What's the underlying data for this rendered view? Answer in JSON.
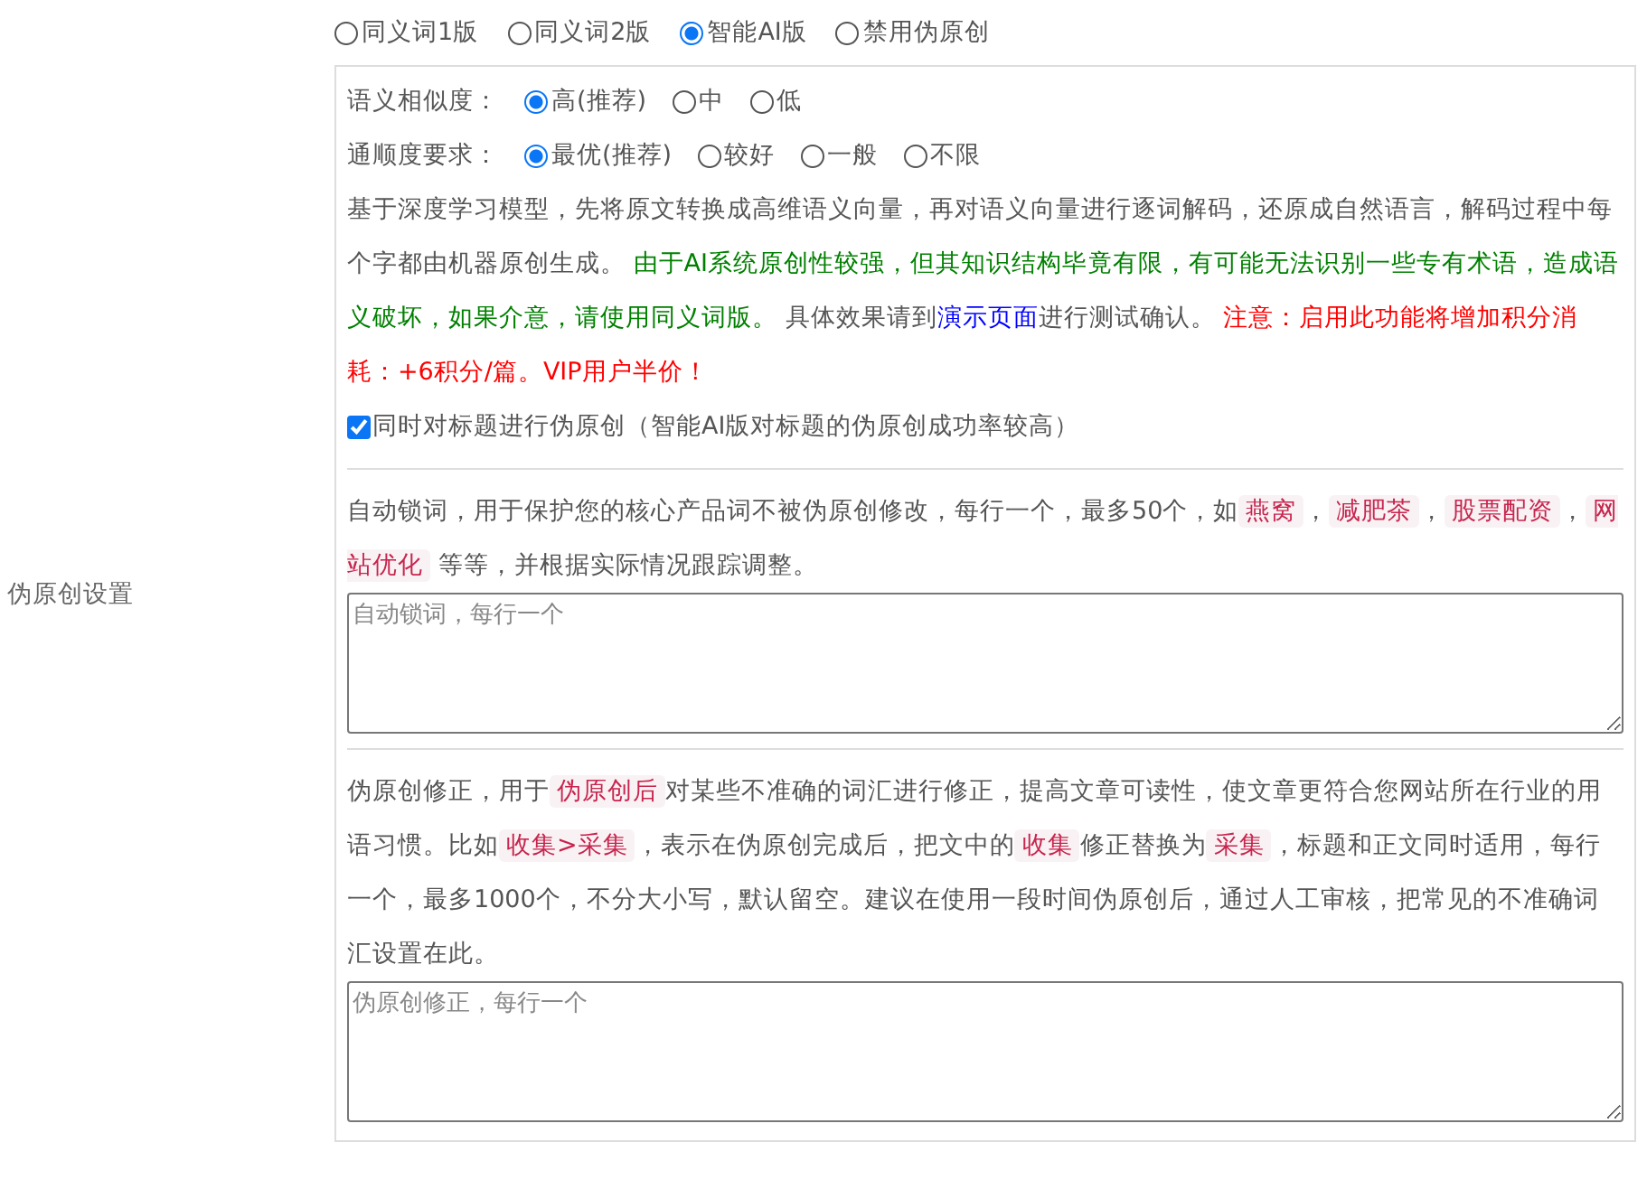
{
  "section_label": "伪原创设置",
  "modes": [
    {
      "label": "同义词1版",
      "selected": false
    },
    {
      "label": "同义词2版",
      "selected": false
    },
    {
      "label": "智能AI版",
      "selected": true
    },
    {
      "label": "禁用伪原创",
      "selected": false
    }
  ],
  "similarity": {
    "label": "语义相似度：",
    "options": [
      {
        "label": "高(推荐)",
        "selected": true
      },
      {
        "label": "中",
        "selected": false
      },
      {
        "label": "低",
        "selected": false
      }
    ]
  },
  "fluency": {
    "label": "通顺度要求：",
    "options": [
      {
        "label": "最优(推荐)",
        "selected": true
      },
      {
        "label": "较好",
        "selected": false
      },
      {
        "label": "一般",
        "selected": false
      },
      {
        "label": "不限",
        "selected": false
      }
    ]
  },
  "description": [
    {
      "kind": "text",
      "text": "基于深度学习模型，先将原文转换成高维语义向量，再对语义向量进行逐词解码，还原成自然语言，解码过程中每个字都由机器原创生成。 "
    },
    {
      "kind": "success",
      "text": "由于AI系统原创性较强，但其知识结构毕竟有限，有可能无法识别一些专有术语，造成语义破坏，如果介意，请使用同义词版。"
    },
    {
      "kind": "text",
      "text": " 具体效果请到"
    },
    {
      "kind": "link",
      "text": "演示页面"
    },
    {
      "kind": "text",
      "text": "进行测试确认。 "
    },
    {
      "kind": "warning",
      "text": "注意：启用此功能将增加积分消耗：+6积分/篇。VIP用户半价！"
    }
  ],
  "title_option": {
    "label": "同时对标题进行伪原创（智能AI版对标题的伪原创成功率较高）",
    "checked": true
  },
  "lock_words": {
    "description": [
      {
        "kind": "text",
        "text": "自动锁词，用于保护您的核心产品词不被伪原创修改，每行一个，最多50个，如"
      },
      {
        "kind": "code",
        "text": "燕窝"
      },
      {
        "kind": "text",
        "text": "，"
      },
      {
        "kind": "code",
        "text": "减肥茶"
      },
      {
        "kind": "text",
        "text": "，"
      },
      {
        "kind": "code",
        "text": "股票配资"
      },
      {
        "kind": "text",
        "text": "，"
      },
      {
        "kind": "code",
        "text": "网站优化"
      },
      {
        "kind": "text",
        "text": " 等等，并根据实际情况跟踪调整。"
      }
    ],
    "placeholder": "自动锁词，每行一个"
  },
  "corrections": {
    "description": [
      {
        "kind": "text",
        "text": "伪原创修正，用于"
      },
      {
        "kind": "code",
        "text": "伪原创后"
      },
      {
        "kind": "text",
        "text": "对某些不准确的词汇进行修正，提高文章可读性，使文章更符合您网站所在行业的用语习惯。比如"
      },
      {
        "kind": "code",
        "text": "收集>采集"
      },
      {
        "kind": "text",
        "text": "，表示在伪原创完成后，把文中的"
      },
      {
        "kind": "code",
        "text": "收集"
      },
      {
        "kind": "text",
        "text": "修正替换为"
      },
      {
        "kind": "code",
        "text": "采集"
      },
      {
        "kind": "text",
        "text": "，标题和正文同时适用，每行一个，最多1000个，不分大小写，默认留空。建议在使用一段时间伪原创后，通过人工审核，把常见的不准确词汇设置在此。"
      }
    ],
    "placeholder": "伪原创修正，每行一个"
  }
}
